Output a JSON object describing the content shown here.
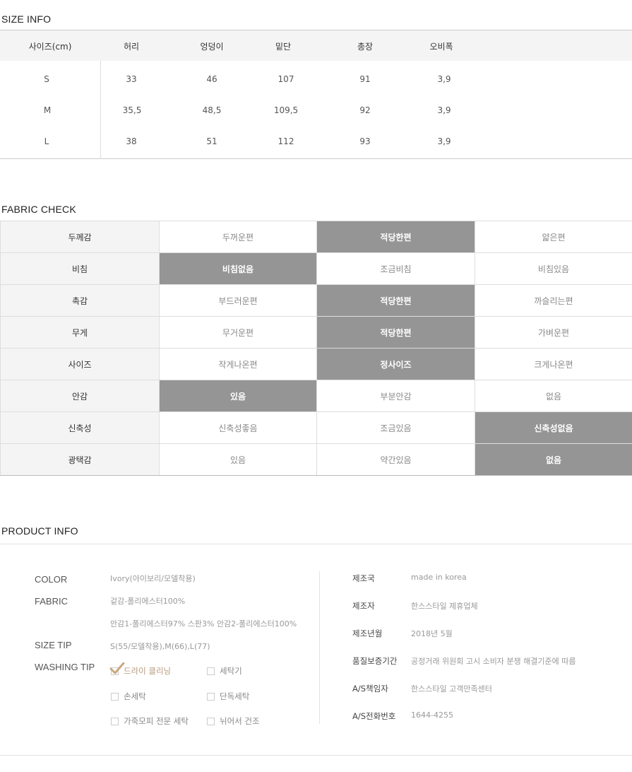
{
  "size_info": {
    "title": "SIZE INFO",
    "headers": [
      "사이즈(cm)",
      "허리",
      "엉덩이",
      "밑단",
      "총장",
      "오비폭"
    ],
    "rows": [
      [
        "S",
        "33",
        "46",
        "107",
        "91",
        "3,9"
      ],
      [
        "M",
        "35,5",
        "48,5",
        "109,5",
        "92",
        "3,9"
      ],
      [
        "L",
        "38",
        "51",
        "112",
        "93",
        "3,9"
      ]
    ]
  },
  "fabric_check": {
    "title": "FABRIC CHECK",
    "rows": [
      {
        "label": "두께감",
        "options": [
          "두꺼운편",
          "적당한편",
          "얇은편"
        ],
        "selected": 1
      },
      {
        "label": "비침",
        "options": [
          "비침없음",
          "조금비침",
          "비침있음"
        ],
        "selected": 0
      },
      {
        "label": "촉감",
        "options": [
          "부드러운편",
          "적당한편",
          "까슬리는편"
        ],
        "selected": 1
      },
      {
        "label": "무게",
        "options": [
          "무거운편",
          "적당한편",
          "가벼운편"
        ],
        "selected": 1
      },
      {
        "label": "사이즈",
        "options": [
          "작게나온편",
          "정사이즈",
          "크게나온편"
        ],
        "selected": 1
      },
      {
        "label": "안감",
        "options": [
          "있음",
          "부분안감",
          "없음"
        ],
        "selected": 0
      },
      {
        "label": "신축성",
        "options": [
          "신축성좋음",
          "조금있음",
          "신축성없음"
        ],
        "selected": 2
      },
      {
        "label": "광택감",
        "options": [
          "있음",
          "약간있음",
          "없음"
        ],
        "selected": 2
      }
    ]
  },
  "product_info": {
    "title": "PRODUCT INFO",
    "color_label": "COLOR",
    "color_value": "Ivory(아이보리/모델착용)",
    "fabric_label": "FABRIC",
    "fabric_value_1": "겉감-폴리에스터100%",
    "fabric_value_2": "안감1-폴리에스터97% 스판3% 안감2-폴리에스터100%",
    "size_tip_label": "SIZE TIP",
    "size_tip_value": "S(55/모델착용),M(66),L(77)",
    "washing_tip_label": "WASHING TIP",
    "washing_options": [
      {
        "label": "드라이 클리닝",
        "checked": true
      },
      {
        "label": "세탁기",
        "checked": false
      },
      {
        "label": "손세탁",
        "checked": false
      },
      {
        "label": "단독세탁",
        "checked": false
      },
      {
        "label": "가죽모피 전문 세탁",
        "checked": false
      },
      {
        "label": "뉘어서 건조",
        "checked": false
      }
    ],
    "right": [
      {
        "label": "제조국",
        "value": "made in korea"
      },
      {
        "label": "제조자",
        "value": "한스스타일 제휴업체"
      },
      {
        "label": "제조년월",
        "value": "2018년 5월"
      },
      {
        "label": "품질보증기간",
        "value": "공정거래 위원회 고시 소비자 분쟁 해결기준에 따름"
      },
      {
        "label": "A/S책임자",
        "value": "한스스타일 고객만족센터"
      },
      {
        "label": "A/S전화번호",
        "value": "1644-4255"
      }
    ]
  },
  "colors": {
    "selected_bg": "#959595",
    "label_bg": "#f4f4f4",
    "check_accent": "#c9a77f"
  }
}
